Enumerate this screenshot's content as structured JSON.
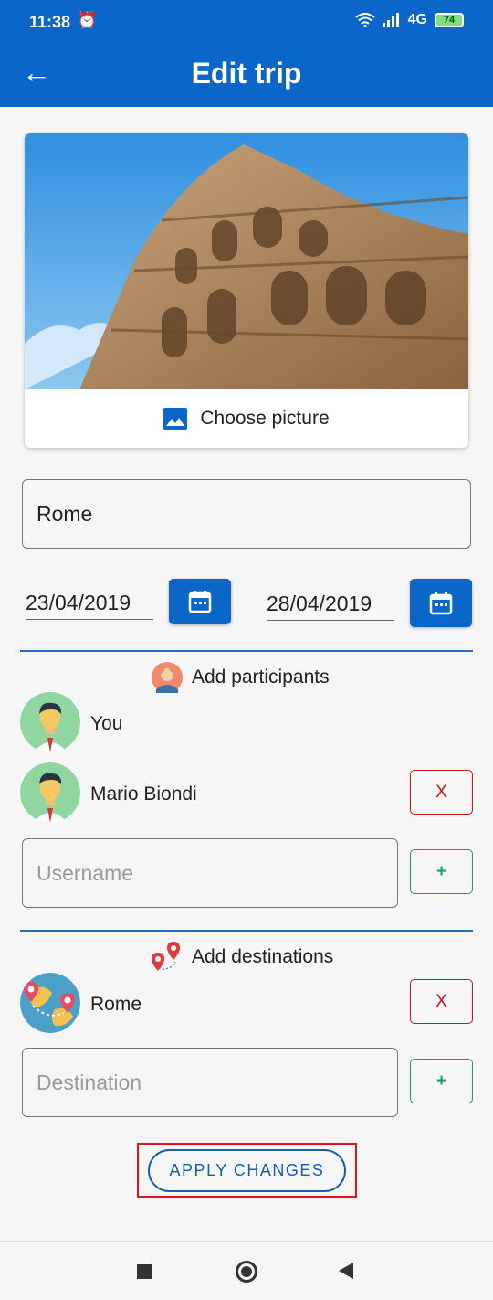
{
  "status_bar": {
    "time": "11:38",
    "network": "4G",
    "battery": "74"
  },
  "app_bar": {
    "title": "Edit trip"
  },
  "picture_card": {
    "choose_label": "Choose picture"
  },
  "trip": {
    "name": "Rome",
    "start_date": "23/04/2019",
    "end_date": "28/04/2019"
  },
  "participants": {
    "heading": "Add participants",
    "items": [
      {
        "name": "You"
      },
      {
        "name": "Mario Biondi",
        "remove_label": "X"
      }
    ],
    "username_placeholder": "Username",
    "add_label": "+"
  },
  "destinations": {
    "heading": "Add destinations",
    "items": [
      {
        "name": "Rome",
        "remove_label": "X"
      }
    ],
    "destination_placeholder": "Destination",
    "add_label": "+"
  },
  "actions": {
    "apply_label": "APPLY CHANGES"
  },
  "colors": {
    "primary": "#0a66c8",
    "danger": "#c41818",
    "success": "#1e9e5a",
    "highlight": "#e0141e"
  }
}
